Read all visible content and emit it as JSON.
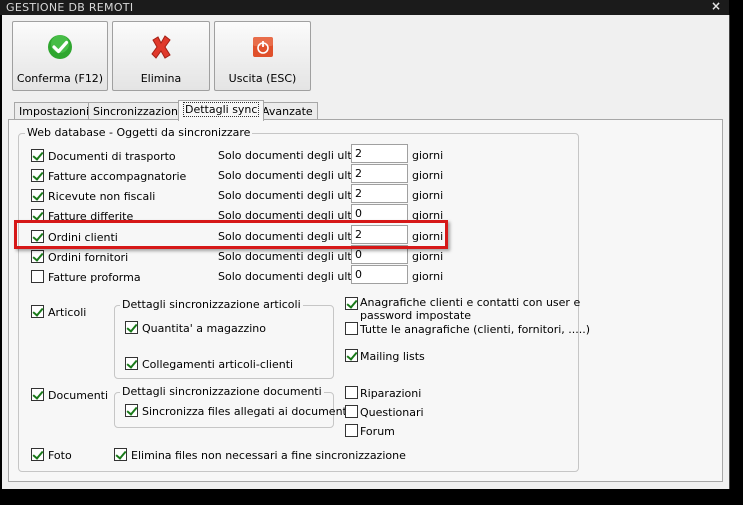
{
  "window": {
    "title": "GESTIONE DB REMOTI",
    "close_glyph": "×"
  },
  "toolbar": {
    "buttons": [
      {
        "label": "Conferma (F12)",
        "icon": "check-icon",
        "color": "#2fa62f"
      },
      {
        "label": "Elimina",
        "icon": "x-delete-icon",
        "color": "#e0392b"
      },
      {
        "label": "Uscita (ESC)",
        "icon": "power-exit-icon",
        "color": "#e0502b"
      }
    ]
  },
  "tabs": [
    {
      "label": "Impostazioni",
      "active": false
    },
    {
      "label": "Sincronizzazione",
      "active": false
    },
    {
      "label": "Dettagli sync",
      "active": true
    },
    {
      "label": "Avanzate",
      "active": false
    }
  ],
  "web_db": {
    "title": "Web database - Oggetti da sincronizzare",
    "rows": [
      {
        "label": "Documenti di trasporto",
        "checked": true,
        "text": "Solo documenti degli ultimi",
        "value": "2",
        "unit": "giorni"
      },
      {
        "label": "Fatture accompagnatorie",
        "checked": true,
        "text": "Solo documenti degli ultimi",
        "value": "2",
        "unit": "giorni"
      },
      {
        "label": "Ricevute non fiscali",
        "checked": true,
        "text": "Solo documenti degli ultimi",
        "value": "2",
        "unit": "giorni"
      },
      {
        "label": "Fatture differite",
        "checked": true,
        "text": "Solo documenti degli ultimi",
        "value": "0",
        "unit": "giorni"
      },
      {
        "label": "Ordini clienti",
        "checked": true,
        "text": "Solo documenti degli ultimi",
        "value": "2",
        "unit": "giorni"
      },
      {
        "label": "Ordini fornitori",
        "checked": true,
        "text": "Solo documenti degli ultimi",
        "value": "0",
        "unit": "giorni"
      },
      {
        "label": "Fatture proforma",
        "checked": false,
        "text": "Solo documenti degli ultimi",
        "value": "0",
        "unit": "giorni"
      }
    ],
    "articoli": {
      "label": "Articoli",
      "checked": true
    },
    "articoli_group": {
      "title": "Dettagli sincronizzazione articoli",
      "items": [
        {
          "label": "Quantita' a magazzino",
          "checked": true
        },
        {
          "label": "Collegamenti articoli-clienti",
          "checked": true
        }
      ]
    },
    "right_options": [
      {
        "label": "Anagrafiche clienti e contatti con user e",
        "label2": "password impostate",
        "checked": true
      },
      {
        "label": "Tutte le anagrafiche (clienti, fornitori, .....)",
        "checked": false
      },
      {
        "label": "Mailing lists",
        "checked": true
      }
    ],
    "documenti": {
      "label": "Documenti",
      "checked": true
    },
    "documenti_group": {
      "title": "Dettagli sincronizzazione documenti",
      "items": [
        {
          "label": "Sincronizza files allegati ai documenti",
          "checked": true
        }
      ]
    },
    "extra_options": [
      {
        "label": "Riparazioni",
        "checked": false
      },
      {
        "label": "Questionari",
        "checked": false
      },
      {
        "label": "Forum",
        "checked": false
      }
    ],
    "foto": {
      "label": "Foto",
      "checked": true
    },
    "elimina_files": {
      "label": "Elimina files non necessari a fine sincronizzazione",
      "checked": true
    }
  },
  "highlight_color": "#d61818"
}
